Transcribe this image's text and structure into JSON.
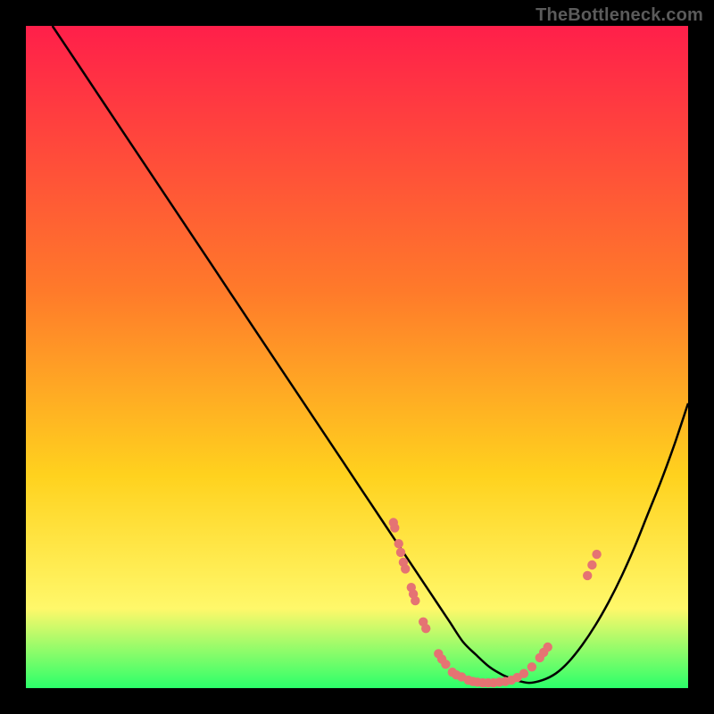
{
  "watermark": "TheBottleneck.com",
  "colors": {
    "gradient_top": "#ff1f4a",
    "gradient_mid1": "#ff7a2a",
    "gradient_mid2": "#ffd21e",
    "gradient_mid3": "#fff86a",
    "gradient_bottom": "#2bff6a",
    "curve": "#000000",
    "dot": "#e57373"
  },
  "chart_data": {
    "type": "line",
    "title": "",
    "xlabel": "",
    "ylabel": "",
    "xlim": [
      0,
      100
    ],
    "ylim": [
      0,
      100
    ],
    "grid": false,
    "legend": false,
    "series": [
      {
        "name": "curve",
        "x": [
          4,
          8,
          12,
          16,
          20,
          24,
          28,
          32,
          36,
          40,
          44,
          48,
          52,
          56,
          60,
          62,
          64,
          66,
          68,
          70,
          72,
          74,
          76,
          78,
          80,
          82,
          84,
          86,
          88,
          90,
          92,
          94,
          96,
          98,
          100
        ],
        "y": [
          100,
          94,
          88,
          82,
          76,
          70,
          64,
          58,
          52,
          46,
          40,
          34,
          28,
          22,
          16,
          13,
          10,
          7,
          5,
          3.2,
          2,
          1.2,
          0.8,
          1.2,
          2.2,
          4,
          6.5,
          9.5,
          13,
          17,
          21.5,
          26.5,
          31.5,
          37,
          43
        ]
      }
    ],
    "points": [
      {
        "x": 55.5,
        "y": 25.0
      },
      {
        "x": 55.7,
        "y": 24.2
      },
      {
        "x": 56.3,
        "y": 21.8
      },
      {
        "x": 56.6,
        "y": 20.5
      },
      {
        "x": 57.0,
        "y": 19.0
      },
      {
        "x": 57.3,
        "y": 18.0
      },
      {
        "x": 58.2,
        "y": 15.2
      },
      {
        "x": 58.5,
        "y": 14.2
      },
      {
        "x": 58.8,
        "y": 13.2
      },
      {
        "x": 60.0,
        "y": 10.0
      },
      {
        "x": 60.4,
        "y": 9.0
      },
      {
        "x": 62.3,
        "y": 5.2
      },
      {
        "x": 62.8,
        "y": 4.4
      },
      {
        "x": 63.4,
        "y": 3.6
      },
      {
        "x": 64.4,
        "y": 2.4
      },
      {
        "x": 65.0,
        "y": 2.0
      },
      {
        "x": 65.8,
        "y": 1.7
      },
      {
        "x": 66.8,
        "y": 1.2
      },
      {
        "x": 67.5,
        "y": 1.0
      },
      {
        "x": 68.2,
        "y": 0.9
      },
      {
        "x": 69.0,
        "y": 0.8
      },
      {
        "x": 69.8,
        "y": 0.8
      },
      {
        "x": 70.6,
        "y": 0.8
      },
      {
        "x": 71.5,
        "y": 0.9
      },
      {
        "x": 72.4,
        "y": 1.0
      },
      {
        "x": 73.3,
        "y": 1.2
      },
      {
        "x": 74.2,
        "y": 1.6
      },
      {
        "x": 75.2,
        "y": 2.2
      },
      {
        "x": 76.4,
        "y": 3.2
      },
      {
        "x": 77.6,
        "y": 4.6
      },
      {
        "x": 78.2,
        "y": 5.4
      },
      {
        "x": 78.8,
        "y": 6.2
      },
      {
        "x": 84.8,
        "y": 17.0
      },
      {
        "x": 85.5,
        "y": 18.6
      },
      {
        "x": 86.2,
        "y": 20.2
      }
    ]
  }
}
